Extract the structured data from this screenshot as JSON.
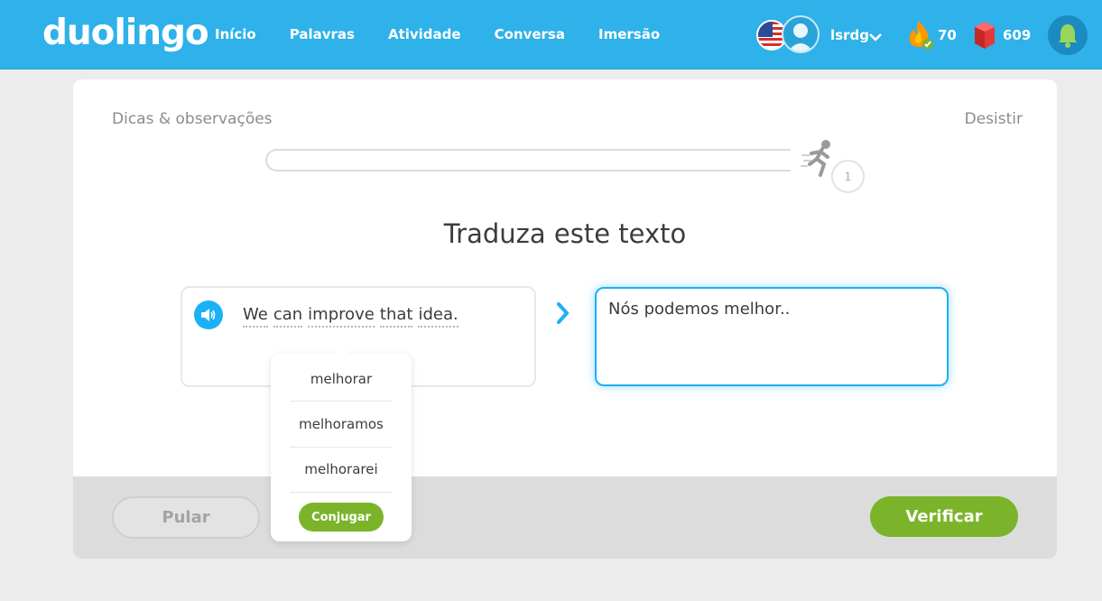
{
  "header": {
    "logo": "duolingo",
    "nav": [
      "Início",
      "Palavras",
      "Atividade",
      "Conversa",
      "Imersão"
    ],
    "username": "lsrdg",
    "streak": "70",
    "gems": "609",
    "colors": {
      "bar": "#2fb1ea",
      "accent": "#7bb42a"
    }
  },
  "lesson": {
    "hints_link": "Dicas & observações",
    "quit_link": "Desistir",
    "level": "1",
    "progress": 0,
    "title": "Traduza este texto",
    "source_words": [
      "We",
      "can",
      "improve",
      "that",
      "idea."
    ],
    "answer": "Nós podemos melhor..",
    "skip_label": "Pular",
    "verify_label": "Verificar"
  },
  "hint_popup": {
    "options": [
      "melhorar",
      "melhoramos",
      "melhorarei"
    ],
    "conjugate_label": "Conjugar"
  }
}
